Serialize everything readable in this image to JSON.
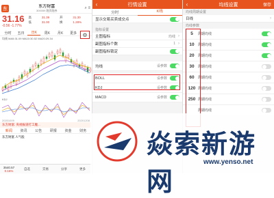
{
  "panel1": {
    "logo_glyph": "东",
    "title": "东方财富",
    "subtitle": "300059 融资融券",
    "icons": "⌕ ≡",
    "price": "31.16",
    "change": "-0.56 -1.77%",
    "stats": [
      "高",
      "31.39",
      "开",
      "31.30",
      "低",
      "31.00",
      "换",
      "1.28%"
    ],
    "ktabs": [
      "分时",
      "五日",
      "日K",
      "周K",
      "月K",
      "更多"
    ],
    "ktab_active": 2,
    "ma_line": "均线 MA5:31.09 MA10:30.52 MA20:29.34",
    "kdj_label": "KDJ",
    "dates": [
      "20201009",
      "20201208"
    ],
    "news_bar": "东方财富: 央视报道打工魔...",
    "tabs2": [
      "新闻",
      "资讯",
      "公告",
      "研报",
      "资金",
      "财务"
    ],
    "tabs2_active": 0,
    "news_item": "东方财富 人气股",
    "bottom": {
      "quote_val": "3540.57",
      "quote_chg": "0.16%",
      "actions": [
        "自选",
        "交易",
        "分享",
        "更多"
      ]
    },
    "highlight_colour": "#e02020"
  },
  "panel2": {
    "title": "行情设置",
    "seg": [
      "分时",
      "K线"
    ],
    "seg_active": 1,
    "rows": [
      {
        "label": "显示交易买卖成交点",
        "type": "toggle",
        "on": true
      },
      {
        "label": "主图指标",
        "value": "均线",
        "type": "arrow"
      },
      {
        "label": "副图指标个数",
        "value": "1",
        "type": "arrow"
      },
      {
        "label": "副图指标锁定",
        "type": "toggle",
        "on": true
      }
    ],
    "section": "指标设置",
    "indicators": [
      {
        "label": "均线",
        "value": "设参数",
        "toggle_on": true
      },
      {
        "label": "BOLL",
        "value": "设参数",
        "toggle_on": true
      },
      {
        "label": "KDJ",
        "value": "设参数",
        "toggle_on": true
      },
      {
        "label": "MACD",
        "value": "设参数",
        "toggle_on": true
      }
    ]
  },
  "panel3": {
    "title": "均线设置",
    "action": "保存",
    "section1": "均线周期设置",
    "day_label": "日线",
    "section2": "均线参数",
    "ma_items": [
      {
        "num": "5",
        "label": "周期均线",
        "on": true
      },
      {
        "num": "10",
        "label": "周期均线",
        "on": true
      },
      {
        "num": "20",
        "label": "周期均线",
        "on": true
      },
      {
        "num": "30",
        "label": "周期均线",
        "on": false
      },
      {
        "num": "60",
        "label": "周期均线",
        "on": false
      },
      {
        "num": "120",
        "label": "周期均线",
        "on": false
      },
      {
        "num": "250",
        "label": "周期均线",
        "on": false
      },
      {
        "num": "",
        "label": "周期均线",
        "on": false
      }
    ]
  },
  "watermark": {
    "text": "焱索新游网",
    "url": "www.yenso.net"
  }
}
